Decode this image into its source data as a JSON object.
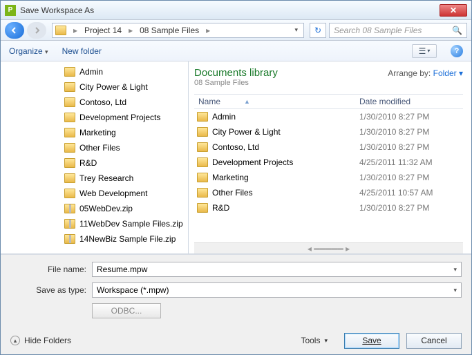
{
  "title": "Save Workspace As",
  "breadcrumb": {
    "seg1": "Project 14",
    "seg2": "08 Sample Files"
  },
  "search": {
    "placeholder": "Search 08 Sample Files"
  },
  "toolbar": {
    "organize": "Organize",
    "newfolder": "New folder"
  },
  "library": {
    "title": "Documents library",
    "subtitle": "08 Sample Files",
    "arrange_label": "Arrange by:",
    "arrange_value": "Folder"
  },
  "columns": {
    "name": "Name",
    "date": "Date modified"
  },
  "tree": [
    {
      "label": "Admin",
      "type": "folder"
    },
    {
      "label": "City Power & Light",
      "type": "folder"
    },
    {
      "label": "Contoso, Ltd",
      "type": "folder"
    },
    {
      "label": "Development Projects",
      "type": "folder"
    },
    {
      "label": "Marketing",
      "type": "folder"
    },
    {
      "label": "Other Files",
      "type": "folder"
    },
    {
      "label": "R&D",
      "type": "folder"
    },
    {
      "label": "Trey Research",
      "type": "folder"
    },
    {
      "label": "Web Development",
      "type": "folder"
    },
    {
      "label": "05WebDev.zip",
      "type": "zip"
    },
    {
      "label": "11WebDev Sample Files.zip",
      "type": "zip"
    },
    {
      "label": "14NewBiz Sample File.zip",
      "type": "zip"
    }
  ],
  "files": [
    {
      "name": "Admin",
      "date": "1/30/2010 8:27 PM"
    },
    {
      "name": "City Power & Light",
      "date": "1/30/2010 8:27 PM"
    },
    {
      "name": "Contoso, Ltd",
      "date": "1/30/2010 8:27 PM"
    },
    {
      "name": "Development Projects",
      "date": "4/25/2011 11:32 AM"
    },
    {
      "name": "Marketing",
      "date": "1/30/2010 8:27 PM"
    },
    {
      "name": "Other Files",
      "date": "4/25/2011 10:57 AM"
    },
    {
      "name": "R&D",
      "date": "1/30/2010 8:27 PM"
    }
  ],
  "form": {
    "filename_label": "File name:",
    "filename_value": "Resume.mpw",
    "type_label": "Save as type:",
    "type_value": "Workspace (*.mpw)",
    "odbc": "ODBC..."
  },
  "footer": {
    "hide": "Hide Folders",
    "tools": "Tools",
    "save": "Save",
    "cancel": "Cancel"
  }
}
